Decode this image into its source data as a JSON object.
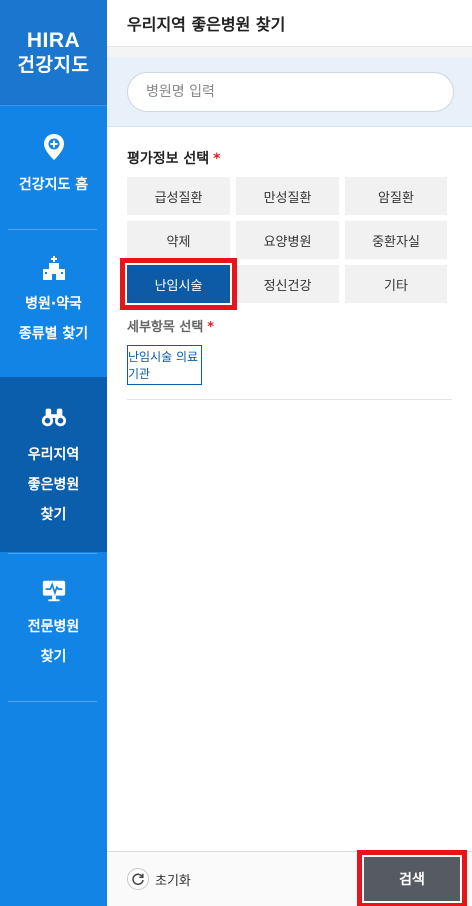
{
  "sidebar": {
    "logo_line1": "HIRA",
    "logo_line2": "건강지도",
    "items": [
      {
        "label": "건강지도 홈",
        "icon": "map-pin-plus-icon"
      },
      {
        "label": "병원·약국\n종류별 찾기",
        "icon": "hospital-building-icon"
      },
      {
        "label": "우리지역\n좋은병원\n찾기",
        "icon": "binoculars-icon",
        "active": true
      },
      {
        "label": "전문병원\n찾기",
        "icon": "monitor-heartbeat-icon"
      }
    ]
  },
  "header": {
    "title": "우리지역 좋은병원 찾기"
  },
  "search": {
    "placeholder": "병원명 입력"
  },
  "evaluation": {
    "title": "평가정보 선택",
    "required_mark": "*",
    "options": [
      {
        "label": "급성질환"
      },
      {
        "label": "만성질환"
      },
      {
        "label": "암질환"
      },
      {
        "label": "약제"
      },
      {
        "label": "요양병원"
      },
      {
        "label": "중환자실"
      },
      {
        "label": "난임시술",
        "selected": true
      },
      {
        "label": "정신건강"
      },
      {
        "label": "기타"
      }
    ]
  },
  "detail": {
    "title": "세부항목 선택",
    "required_mark": "*",
    "options": [
      {
        "label": "난임시술 의료기관"
      }
    ]
  },
  "footer": {
    "reset_label": "초기화",
    "search_label": "검색"
  },
  "colors": {
    "sidebar": "#1184e6",
    "sidebar_active": "#0b5eab",
    "selected_chip": "#0d5aa7",
    "highlight": "#e8141c",
    "search_button": "#555b61"
  }
}
